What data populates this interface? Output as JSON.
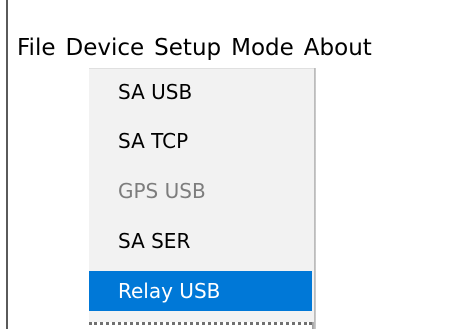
{
  "menubar": {
    "items": [
      {
        "label": "File"
      },
      {
        "label": "Device"
      },
      {
        "label": "Setup"
      },
      {
        "label": "Mode"
      },
      {
        "label": "About"
      }
    ]
  },
  "device_menu": {
    "items": [
      {
        "label": "SA USB",
        "state": "enabled"
      },
      {
        "label": "SA TCP",
        "state": "enabled"
      },
      {
        "label": "GPS USB",
        "state": "disabled"
      },
      {
        "label": "SA SER",
        "state": "enabled"
      },
      {
        "label": "Relay USB",
        "state": "highlighted"
      }
    ]
  },
  "colors": {
    "highlight": "#0078d7",
    "disabled_text": "#7d7d7d",
    "menu_background": "#f2f2f2"
  }
}
